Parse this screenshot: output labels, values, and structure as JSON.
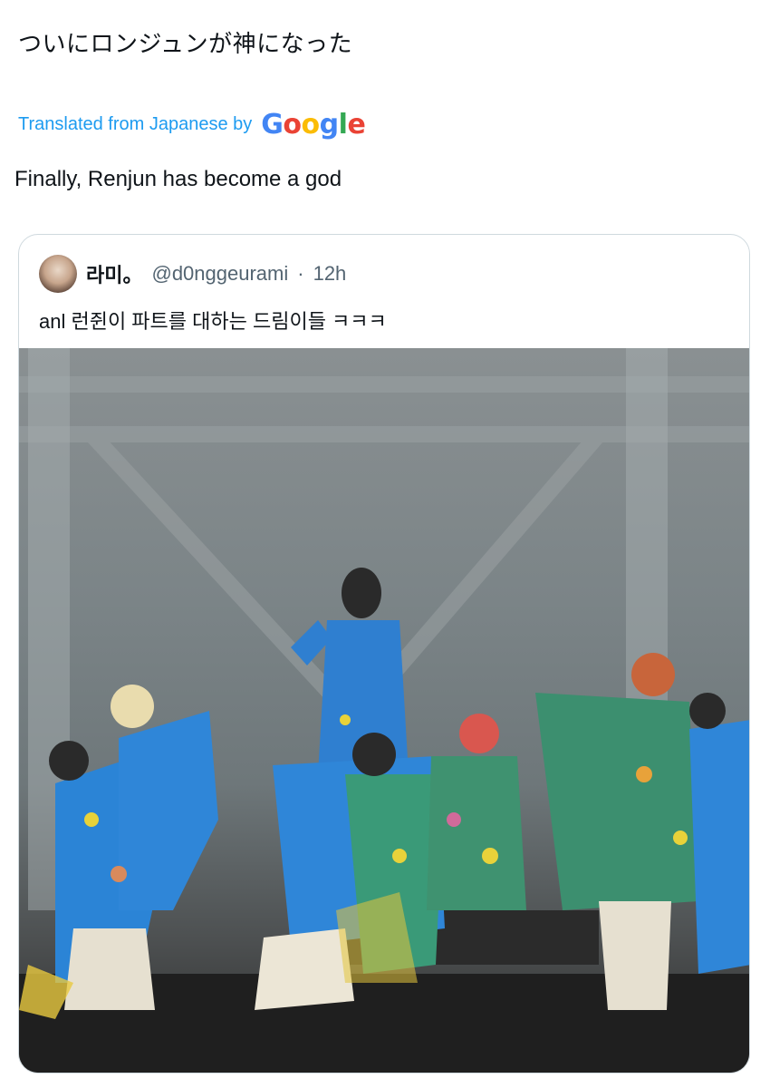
{
  "tweet": {
    "text": "ついにロンジュンが神になった",
    "translated_label": "Translated from Japanese by",
    "google_logo": "Google",
    "translated_text": "Finally, Renjun has become a god"
  },
  "quote": {
    "display_name": "라미。",
    "handle": "@d0nggeurami",
    "separator": "·",
    "time": "12h",
    "text": "anl 런쥔이 파트를 대하는 드림이들 ㅋㅋㅋ"
  },
  "colors": {
    "link": "#1d9bf0",
    "secondary_text": "#536471",
    "border": "#cfd9de"
  }
}
